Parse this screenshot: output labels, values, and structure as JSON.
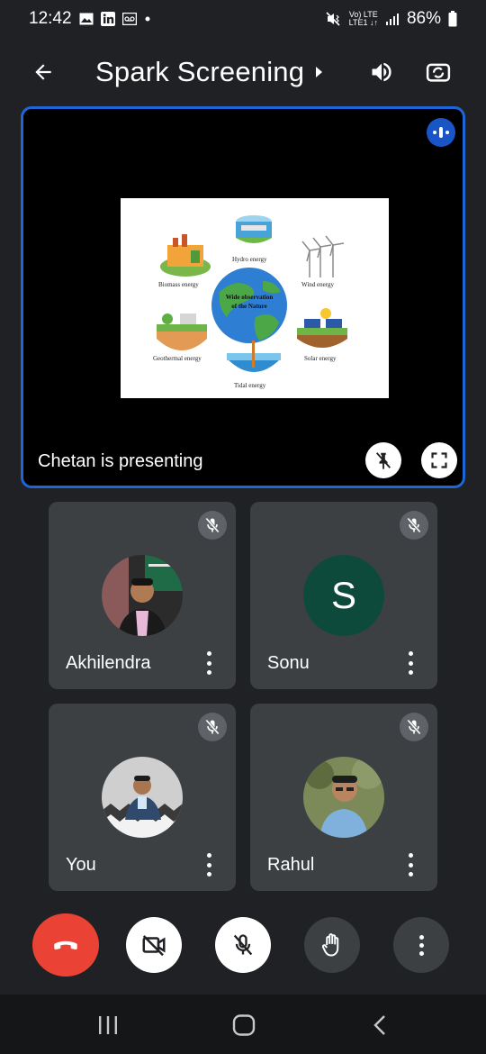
{
  "status_bar": {
    "time": "12:42",
    "battery": "86%",
    "left_icons": [
      "gallery-icon",
      "linkedin-icon",
      "voicemail-icon",
      "dot-icon"
    ],
    "right_icons": [
      "mute-vibrate-icon",
      "volte-lte-icon",
      "signal-icon",
      "battery-icon"
    ],
    "network_top": "Vo) LTE",
    "network_bottom": "LTE1 ↓↑"
  },
  "header": {
    "title": "Spark Screening",
    "icons": [
      "back-arrow-icon",
      "chevron-right-icon",
      "speaker-icon",
      "switch-camera-icon"
    ]
  },
  "presentation": {
    "status": "Chetan is presenting",
    "slide": {
      "center_line1": "Wide observation",
      "center_line2": "of the Nature",
      "labels": {
        "hydro": "Hydro energy",
        "biomass": "Biomass energy",
        "wind": "Wind energy",
        "geothermal": "Geothermal energy",
        "solar": "Solar energy",
        "tidal": "Tidal energy"
      }
    },
    "icons": [
      "speaking-indicator-icon",
      "unpin-icon",
      "fullscreen-icon"
    ]
  },
  "participants": [
    {
      "name": "Akhilendra",
      "avatar": "photo",
      "muted": true
    },
    {
      "name": "Sonu",
      "avatar": "letter",
      "letter": "S",
      "muted": true
    },
    {
      "name": "You",
      "avatar": "photo",
      "muted": true
    },
    {
      "name": "Rahul",
      "avatar": "photo",
      "muted": true
    }
  ],
  "controls": [
    "end-call-icon",
    "camera-off-icon",
    "mic-off-icon",
    "raise-hand-icon",
    "more-options-icon"
  ],
  "nav": [
    "recents-icon",
    "home-icon",
    "back-icon"
  ],
  "colors": {
    "background": "#202124",
    "tile": "#3c4043",
    "accent_blue": "#1e66d8",
    "end_call_red": "#ea4335",
    "sonu_avatar": "#0e4a3b"
  }
}
